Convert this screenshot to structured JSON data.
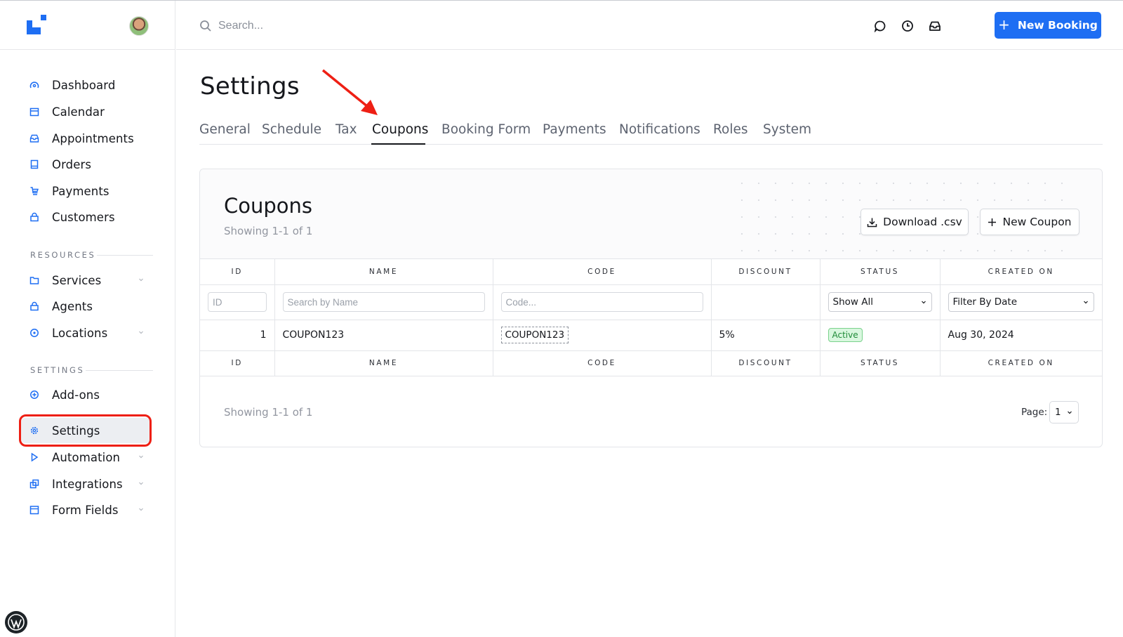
{
  "sidebar": {
    "main_items": [
      {
        "label": "Dashboard"
      },
      {
        "label": "Calendar"
      },
      {
        "label": "Appointments"
      },
      {
        "label": "Orders"
      },
      {
        "label": "Payments"
      },
      {
        "label": "Customers"
      }
    ],
    "resources_title": "RESOURCES",
    "resources_items": [
      {
        "label": "Services"
      },
      {
        "label": "Agents"
      },
      {
        "label": "Locations"
      }
    ],
    "settings_title": "SETTINGS",
    "settings_items": [
      {
        "label": "Add-ons"
      },
      {
        "label": "Settings"
      },
      {
        "label": "Automation"
      },
      {
        "label": "Integrations"
      },
      {
        "label": "Form Fields"
      }
    ]
  },
  "topbar": {
    "search_placeholder": "Search...",
    "new_booking_label": "New Booking",
    "accent_color": "#1e6ef3"
  },
  "page": {
    "title": "Settings",
    "tabs": [
      "General",
      "Schedule",
      "Tax",
      "Coupons",
      "Booking Form",
      "Payments",
      "Notifications",
      "Roles",
      "System"
    ],
    "active_tab": "Coupons"
  },
  "coupons": {
    "title": "Coupons",
    "subtitle": "Showing 1-1 of 1",
    "download_label": "Download .csv",
    "new_coupon_label": "New Coupon",
    "columns": [
      "ID",
      "NAME",
      "CODE",
      "DISCOUNT",
      "STATUS",
      "CREATED ON"
    ],
    "filters": {
      "id_placeholder": "ID",
      "name_placeholder": "Search by Name",
      "code_placeholder": "Code...",
      "status_value": "Show All",
      "date_value": "Filter By Date"
    },
    "rows": [
      {
        "id": "1",
        "name": "COUPON123",
        "code": "COUPON123",
        "discount": "5%",
        "status": "Active",
        "created_on": "Aug 30, 2024"
      }
    ],
    "footer_text": "Showing 1-1 of 1",
    "page_label": "Page:",
    "page_value": "1"
  }
}
